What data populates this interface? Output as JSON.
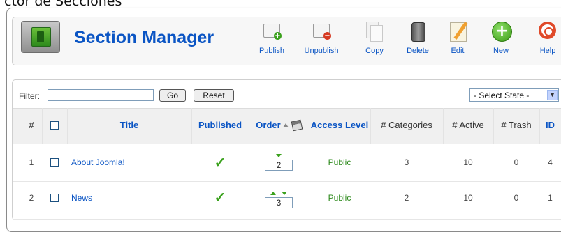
{
  "window_caption": "ctor de Secciones",
  "header": {
    "title": "Section Manager",
    "toolbar": [
      {
        "label": "Publish",
        "icon": "publish-icon"
      },
      {
        "label": "Unpublish",
        "icon": "unpublish-icon"
      },
      {
        "label": "Copy",
        "icon": "copy-icon"
      },
      {
        "label": "Delete",
        "icon": "delete-icon"
      },
      {
        "label": "Edit",
        "icon": "edit-icon"
      },
      {
        "label": "New",
        "icon": "new-icon"
      },
      {
        "label": "Help",
        "icon": "help-icon"
      }
    ]
  },
  "filter": {
    "label": "Filter:",
    "value": "",
    "go_label": "Go",
    "reset_label": "Reset",
    "state_select": "- Select State -"
  },
  "table": {
    "columns": [
      "#",
      "",
      "Title",
      "Published",
      "Order",
      "Access Level",
      "# Categories",
      "# Active",
      "# Trash",
      "ID"
    ],
    "rows": [
      {
        "num": "1",
        "title": "About Joomla!",
        "published": true,
        "order": "2",
        "access": "Public",
        "categories": "3",
        "active": "10",
        "trash": "0",
        "id": "4"
      },
      {
        "num": "2",
        "title": "News",
        "published": true,
        "order": "3",
        "access": "Public",
        "categories": "2",
        "active": "10",
        "trash": "0",
        "id": "1"
      }
    ]
  },
  "colors": {
    "link": "#0b55c4",
    "published_check": "#3aa11c",
    "header_bg": "#f0f0f0"
  }
}
